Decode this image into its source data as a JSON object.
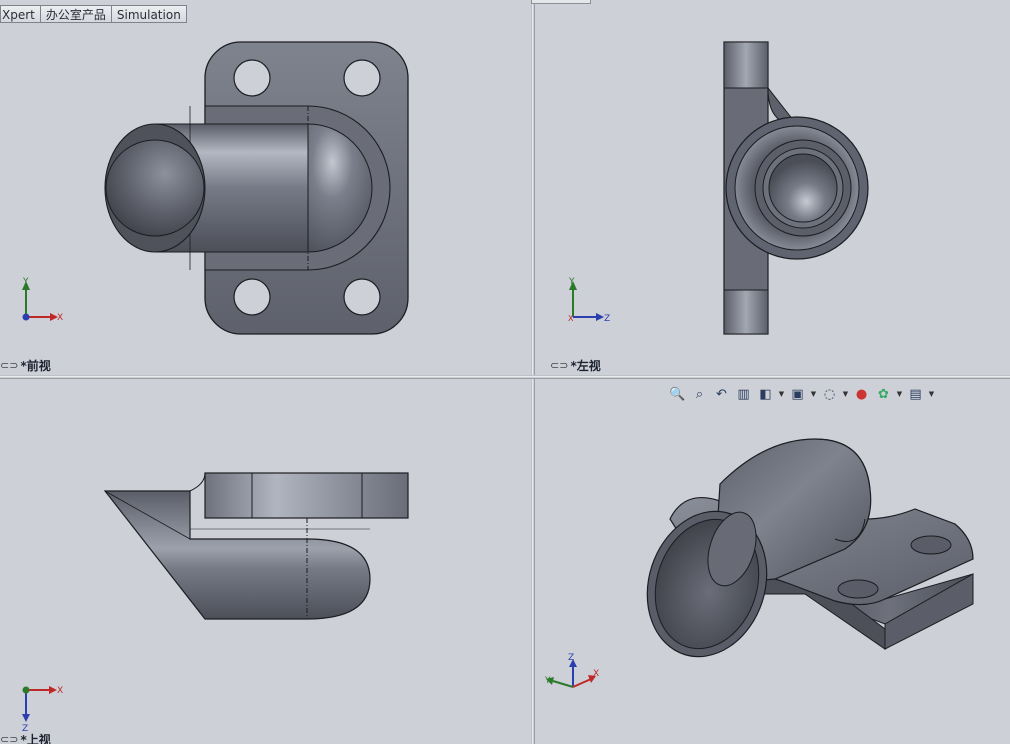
{
  "tabs": [
    {
      "label": "Xpert"
    },
    {
      "label": "办公室产品"
    },
    {
      "label": "Simulation"
    }
  ],
  "views": {
    "front": {
      "label": "*前视",
      "axes": {
        "v": "Y",
        "h": "X"
      }
    },
    "left": {
      "label": "*左视",
      "axes": {
        "v": "Y",
        "h": "Z",
        "o": "X"
      }
    },
    "top": {
      "label": "*上视",
      "axes": {
        "v": "Z",
        "h": "X"
      }
    },
    "iso": {
      "axes": {
        "z": "Z",
        "y": "Y",
        "x": "X"
      }
    }
  },
  "toolbar": {
    "items": [
      {
        "icon": "zoom-to-fit-icon",
        "glyph": "🔍"
      },
      {
        "icon": "zoom-to-area-icon",
        "glyph": "⌕"
      },
      {
        "icon": "previous-view-icon",
        "glyph": "↶"
      },
      {
        "icon": "section-view-icon",
        "glyph": "▥"
      },
      {
        "icon": "view-orientation-icon",
        "glyph": "◧"
      },
      {
        "icon": "display-style-icon",
        "glyph": "▣"
      },
      {
        "icon": "hide-show-items-icon",
        "glyph": "◌"
      },
      {
        "icon": "edit-appearance-icon",
        "glyph": "●"
      },
      {
        "icon": "apply-scene-icon",
        "glyph": "✿"
      },
      {
        "icon": "view-settings-icon",
        "glyph": "▤"
      }
    ]
  },
  "colors": {
    "background": "#cdd0d6",
    "part_dark": "#5b5e68",
    "part_mid": "#7a7e8a",
    "part_light": "#a7abb6",
    "axis_x": "#c02828",
    "axis_y": "#2a7a2a",
    "axis_z": "#2a3eb0"
  }
}
